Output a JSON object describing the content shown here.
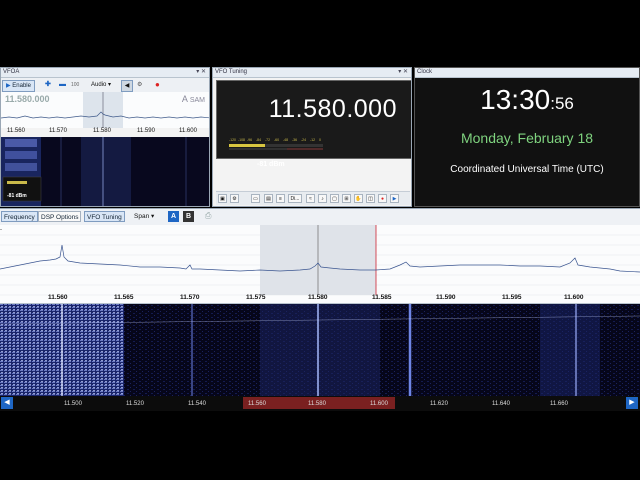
{
  "vfoa": {
    "title": "VFOA",
    "enable_label": "Enable",
    "audio_label": "Audio",
    "small_value": "100",
    "mini_frequency": "11.580.000",
    "mode_letter": "A",
    "mode_label": "SAM",
    "axis_labels": [
      "11.560",
      "11.570",
      "11.580",
      "11.590",
      "11.600"
    ],
    "signal_level": "-81 dBm"
  },
  "vfo_tuning": {
    "title": "VFO Tuning",
    "frequency": "11.580.000",
    "meter_scale": [
      "-120",
      "-108",
      "-96",
      "-84",
      "-72",
      "-60",
      "-48",
      "-36",
      "-24",
      "-12",
      "0"
    ],
    "signal_level": "-81 dBm",
    "toolbar_labels": [
      "Di..."
    ]
  },
  "clock": {
    "title": "Clock",
    "time_hm": "13:30",
    "time_s": ":56",
    "date": "Monday, February 18",
    "zone": "Coordinated Universal Time (UTC)"
  },
  "tabs": {
    "items": [
      "Frequency",
      "DSP Options",
      "VFO Tuning",
      "Span"
    ],
    "a_label": "A",
    "b_label": "B"
  },
  "spectrum": {
    "axis_labels": [
      "11.560",
      "11.565",
      "11.570",
      "11.575",
      "11.580",
      "11.585",
      "11.590",
      "11.595",
      "11.600"
    ]
  },
  "scroll_axis": {
    "labels": [
      "11.500",
      "11.520",
      "11.540",
      "11.560",
      "11.580",
      "11.600",
      "11.620",
      "11.640",
      "11.660"
    ]
  },
  "colors": {
    "accent": "#1e66c4",
    "clock_date": "#7fd37f",
    "selection": "#7a2020"
  }
}
